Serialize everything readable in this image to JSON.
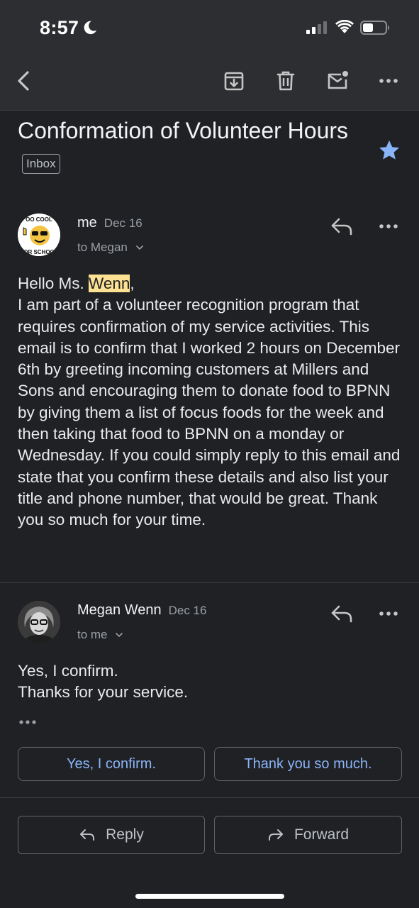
{
  "status_bar": {
    "time": "8:57",
    "icons": [
      "moon-icon",
      "signal-icon",
      "wifi-icon",
      "battery-icon"
    ]
  },
  "toolbar": {
    "icons": [
      "back-arrow-icon",
      "archive-icon",
      "trash-icon",
      "mark-unread-icon",
      "more-icon"
    ]
  },
  "email": {
    "subject": "Conformation of Volunteer Hours",
    "label": "Inbox",
    "starred": true
  },
  "messages": [
    {
      "sender": "me",
      "date": "Dec 16",
      "recipients": "to Megan",
      "avatar_text": [
        "OO COOL",
        "OR SCHOO"
      ],
      "greeting_prefix": "Hello Ms. ",
      "greeting_highlight": "Wenn",
      "greeting_suffix": ",",
      "body": "I am part of a volunteer recognition program that requires confirmation of my service activities. This email is to confirm that I worked 2 hours on December 6th by greeting incoming customers at Millers and Sons and encouraging them to donate food to BPNN by giving them a list of focus foods for the week and then taking that food to BPNN on a monday or Wednesday. If you could simply reply to this email and state that you confirm these details and also list your title and phone number, that would be great. Thank you so much for your time."
    },
    {
      "sender": "Megan Wenn",
      "date": "Dec 16",
      "recipients": "to me",
      "body": "Yes, I confirm.\nThanks for your service."
    }
  ],
  "smart_replies": [
    "Yes, I confirm.",
    "Thank you so much."
  ],
  "actions": {
    "reply": "Reply",
    "forward": "Forward"
  },
  "colors": {
    "background": "#202124",
    "accent": "#8ab4f8",
    "star": "#8ab4f8",
    "highlight": "#fde293"
  }
}
